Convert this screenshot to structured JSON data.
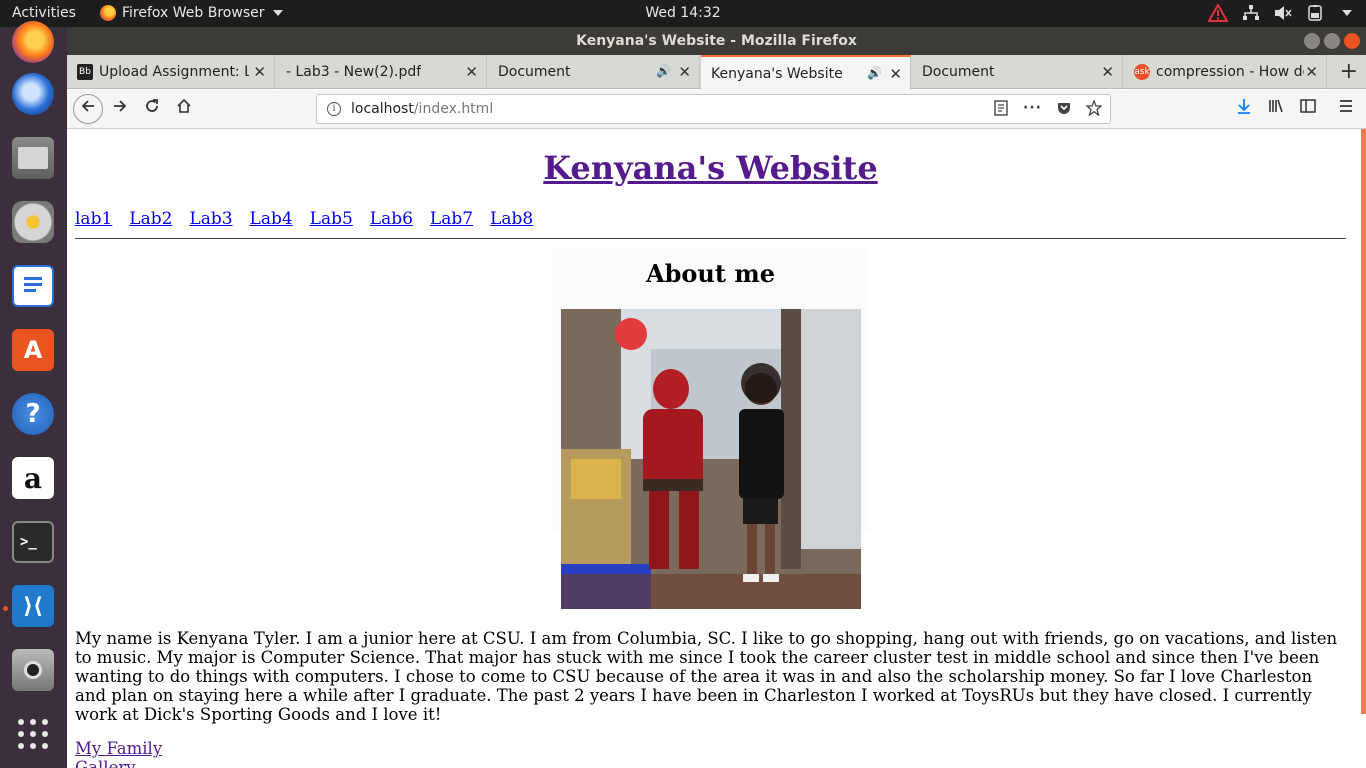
{
  "topbar": {
    "activities": "Activities",
    "app_name": "Firefox Web Browser",
    "clock": "Wed 14:32"
  },
  "window": {
    "title": "Kenyana's Website - Mozilla Firefox"
  },
  "tabs": [
    {
      "label": "Upload Assignment: La",
      "favicon": "blackboard-icon",
      "active": false
    },
    {
      "label": "- Lab3 - New(2).pdf",
      "favicon": "",
      "active": false
    },
    {
      "label": "Document",
      "favicon": "",
      "active": false,
      "audio": true
    },
    {
      "label": "Kenyana's Website",
      "favicon": "",
      "active": true,
      "audio": true
    },
    {
      "label": "Document",
      "favicon": "",
      "active": false
    },
    {
      "label": "compression - How do",
      "favicon": "ask-icon",
      "active": false
    }
  ],
  "url": {
    "host": "localhost",
    "path": "/index.html"
  },
  "page": {
    "title": "Kenyana's Website",
    "nav": [
      "lab1",
      "Lab2",
      "Lab3",
      "Lab4",
      "Lab5",
      "Lab6",
      "Lab7",
      "Lab8"
    ],
    "about_title": "About me",
    "bio": "My name is Kenyana Tyler. I am a junior here at CSU. I am from Columbia, SC. I like to go shopping, hang out with friends, go on vacations, and listen to music. My major is Computer Science. That major has stuck with me since I took the career cluster test in middle school and since then I've been wanting to do things with computers. I chose to come to CSU because of the area it was in and also the scholarship money. So far I love Charleston and plan on staying here a while after I graduate. The past 2 years I have been in Charleston I worked at ToysRUs but they have closed. I currently work at Dick's Sporting Goods and I love it!",
    "links": [
      "My Family",
      "Gallery"
    ]
  },
  "colors": {
    "visited_link": "#551a8b",
    "link": "#0000ee",
    "accent": "#ff7139"
  }
}
